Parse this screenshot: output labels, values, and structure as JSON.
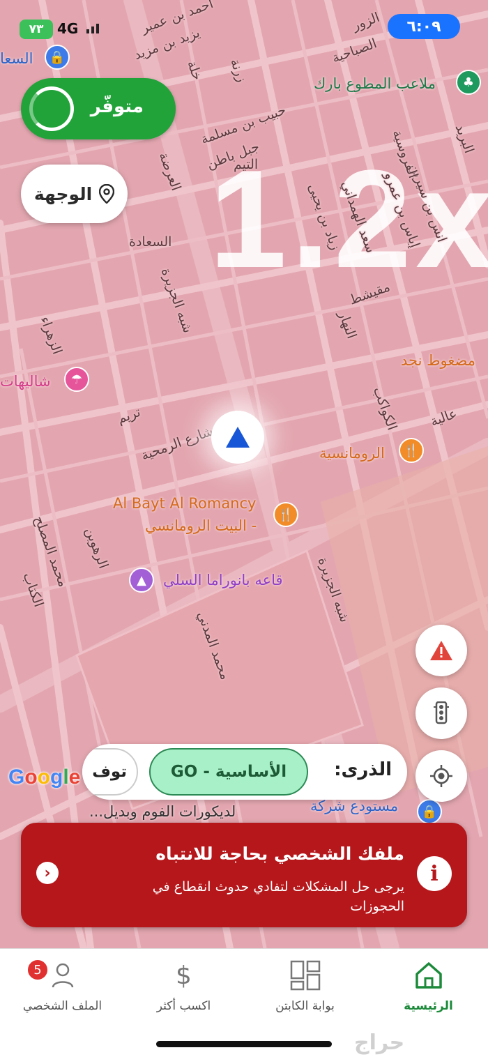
{
  "status_bar": {
    "battery": "٧٣",
    "network": "4G",
    "time": "٦:٠٩"
  },
  "availability": {
    "label": "متوفّر"
  },
  "destination": {
    "label": "الوجهة",
    "icon": "location-pin-icon"
  },
  "map": {
    "zoom_watermark": "1.2x",
    "google_logo": "Google",
    "street_labels": [
      "السعادة",
      "شبه الجزيرة",
      "شارع الرمحية",
      "تريم",
      "الزهراء",
      "النهار",
      "مقيشط",
      "الكواكب",
      "سعد الهمداني",
      "زياد بن يحيى",
      "إياس بن عمرو",
      "انس بن سيرين",
      "الفروسية",
      "التيم",
      "جبل باطن",
      "حبيب بن مسلمة",
      "العرضة",
      "زرنة",
      "خلة",
      "يزيد بن مزيد",
      "أحمد بن عمير",
      "الصباحية",
      "البريد",
      "عالية",
      "محمد المصلح",
      "الرهوين",
      "الكتاب",
      "محمد المدني",
      "شبه الجزيرة",
      "الزور"
    ],
    "pois": [
      {
        "name": "ملاعب المطوع بارك",
        "icon": "park-icon",
        "color": "#1f9a5e"
      },
      {
        "name": "مضغوط نجد",
        "icon": "",
        "color": "#d46a1a"
      },
      {
        "name": "الرومانسية",
        "icon": "restaurant-icon",
        "color": "#d46a1a"
      },
      {
        "name": "Al Bayt Al Romancy",
        "icon": "restaurant-icon",
        "color": "#d46a1a"
      },
      {
        "name": "- البيت الرومانسي",
        "icon": "",
        "color": "#d46a1a"
      },
      {
        "name": "قاعه بانوراما السلي",
        "icon": "venue-icon",
        "color": "#8f3fc6"
      },
      {
        "name": "شاليهات",
        "icon": "beach-icon",
        "color": "#d43f8a"
      },
      {
        "name": "مستودع شركة",
        "icon": "shopping-icon",
        "color": "#2b64c9"
      },
      {
        "name": "لديكورات الفوم وبديل...",
        "icon": "",
        "color": "#333333"
      },
      {
        "name": "السعا",
        "icon": "shopping-icon",
        "color": "#2b64c9"
      }
    ]
  },
  "fabs": {
    "report": "warning-icon",
    "traffic": "traffic-light-icon",
    "locate": "my-location-icon"
  },
  "service_bar": {
    "peak_label": "الذرى:",
    "chip_selected": "الأساسية - GO",
    "chip_partial": "توف"
  },
  "alert": {
    "title": "ملفك الشخصي بحاجة للانتباه",
    "body": "يرجى حل المشكلات لتفادي حدوث انقطاع في الحجوزات"
  },
  "bottom_nav": {
    "items": [
      {
        "label": "الرئيسية",
        "icon": "home-icon",
        "active": true
      },
      {
        "label": "بوابة الكابتن",
        "icon": "grid-icon",
        "active": false
      },
      {
        "label": "اكسب أكثر",
        "icon": "dollar-icon",
        "active": false
      },
      {
        "label": "الملف الشخصي",
        "icon": "person-icon",
        "active": false,
        "badge": "5"
      }
    ]
  },
  "watermark": "حراج",
  "colors": {
    "map_bg": "#e3a6b0",
    "available_green": "#21a33a",
    "alert_red": "#b5171b",
    "clock_blue": "#1a73ff",
    "active_nav": "#1c8a3a"
  }
}
